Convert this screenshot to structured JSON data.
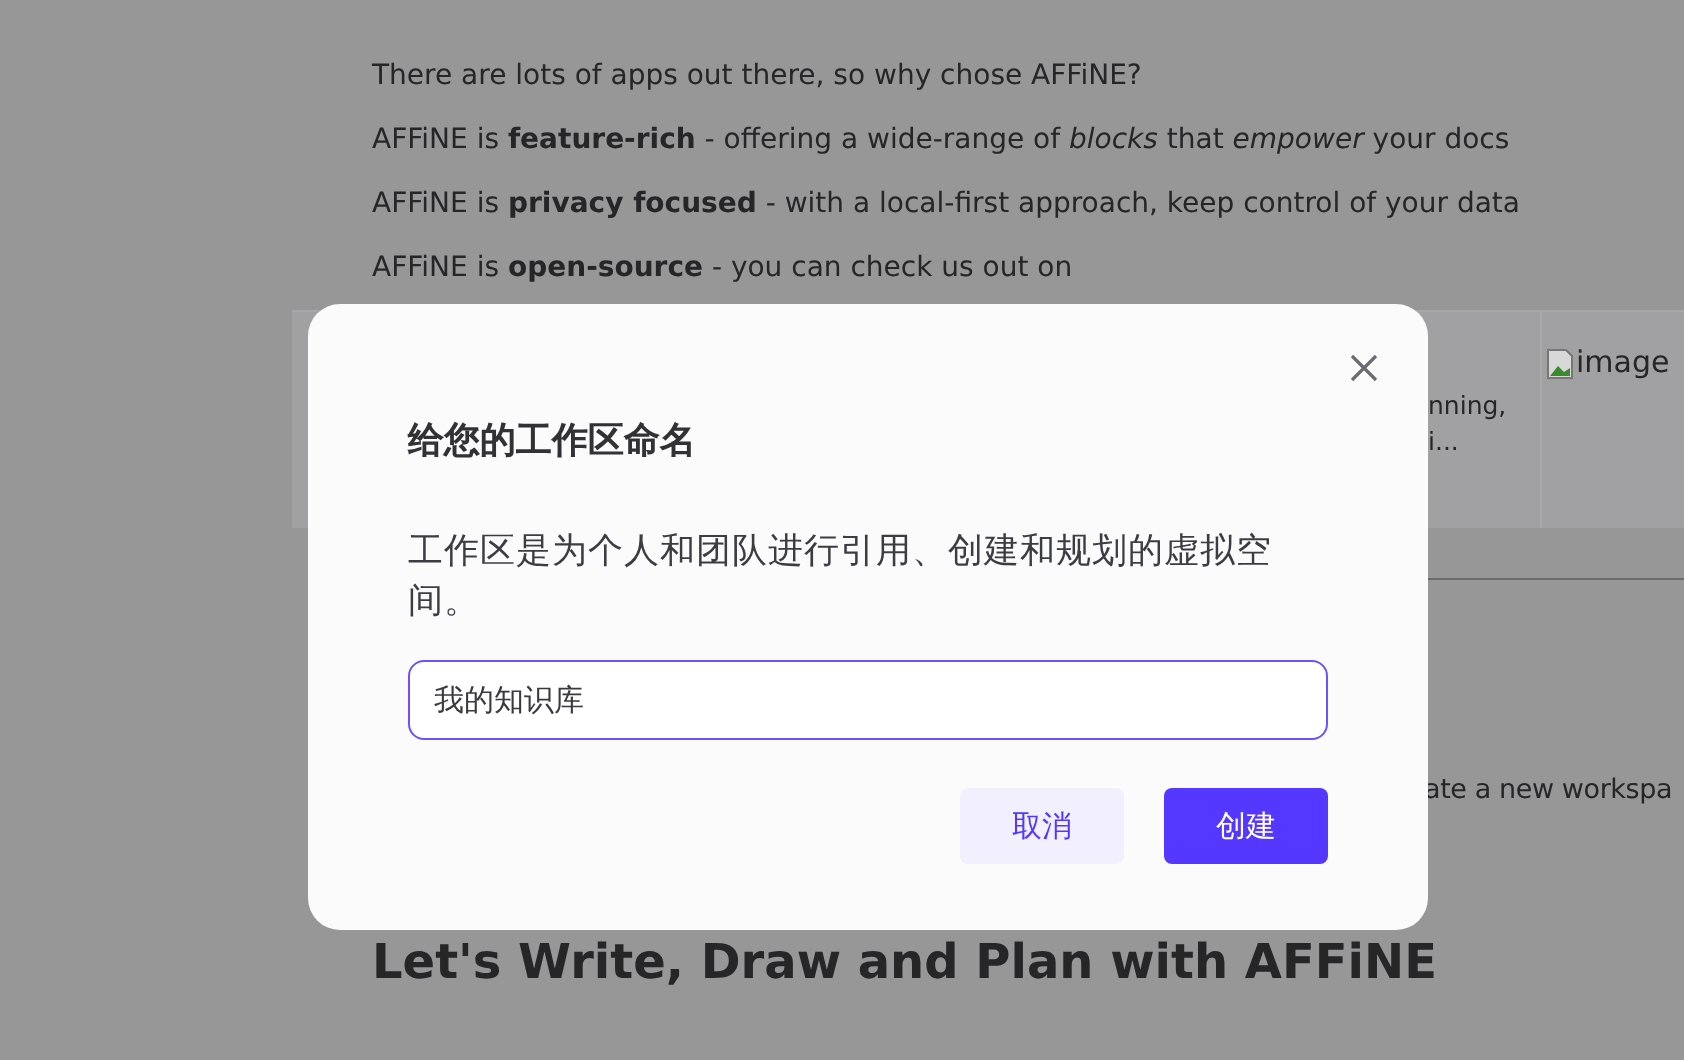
{
  "document": {
    "paragraphs": [
      "There are lots of apps out there, so why chose AFFiNE?",
      "AFFiNE is **feature-rich** - offering a wide-range of *blocks* that *empower* your docs",
      "AFFiNE is **privacy focused** - with a local-first approach, keep control of your data",
      "AFFiNE is **open-source** - you can check us out on"
    ],
    "card_texts": [
      "nning,",
      "i..."
    ],
    "broken_image_alt": "image",
    "partial_text": "ate a new workspa",
    "heading": "Let's Write, Draw and Plan with AFFiNE"
  },
  "dialog": {
    "title": "给您的工作区命名",
    "description": "工作区是为个人和团队进行引用、创建和规划的虚拟空间。",
    "input": {
      "value": "我的知识库",
      "focused": true
    },
    "buttons": [
      {
        "label": "取消",
        "kind": "secondary"
      },
      {
        "label": "创建",
        "kind": "primary"
      }
    ]
  }
}
